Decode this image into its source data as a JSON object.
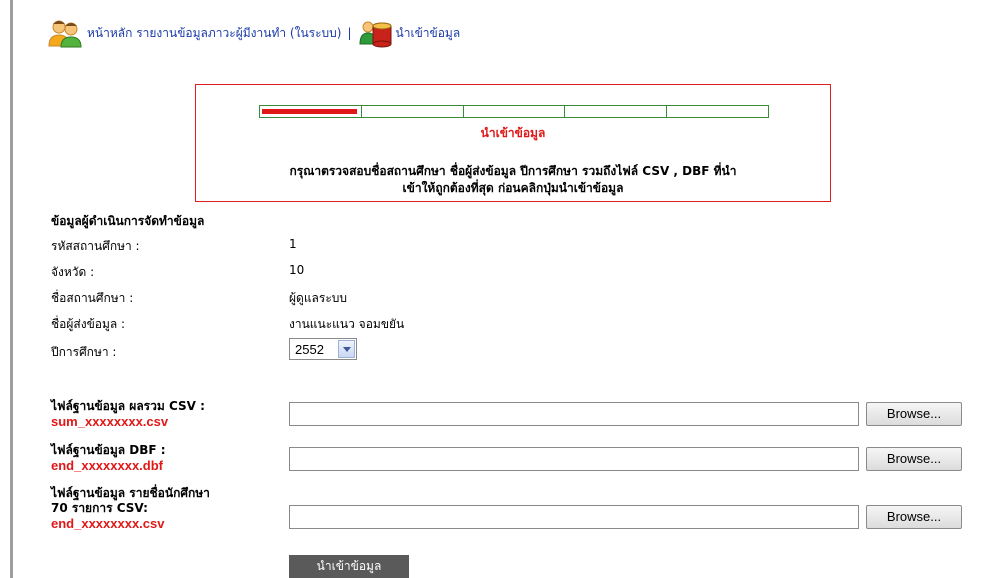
{
  "nav": {
    "home_link": "หน้าหลัก รายงานข้อมูลภาวะผู้มีงานทำ (ในระบบ)",
    "separator": "|",
    "import_link": "นำเข้าข้อมูล"
  },
  "progress": {
    "total_steps": 5,
    "current_step": 1,
    "title": "นำเข้าข้อมูล",
    "notice_line1": "กรุณาตรวจสอบชื่อสถานศึกษา ชื่อผู้ส่งข้อมูล ปีการศึกษา รวมถึงไฟล์ CSV , DBF ที่นำ",
    "notice_line2": "เข้าให้ถูกต้องที่สุด ก่อนคลิกปุ่มนำเข้าข้อมูล"
  },
  "info": {
    "section_title": "ข้อมูลผู้ดำเนินการจัดทำข้อมูล",
    "rows": [
      {
        "label": "รหัสสถานศึกษา :",
        "value": "1"
      },
      {
        "label": "จังหวัด :",
        "value": "10"
      },
      {
        "label": "ชื่อสถานศึกษา :",
        "value": "ผู้ดูแลระบบ"
      },
      {
        "label": "ชื่อผู้ส่งข้อมูล :",
        "value": "งานแนะแนว จอมขยัน"
      }
    ],
    "year_label": "ปีการศึกษา :",
    "year_value": "2552"
  },
  "files": [
    {
      "label_line1": "ไฟล์ฐานข้อมูล ผลรวม CSV :",
      "label_line2": "",
      "filename": "sum_xxxxxxxx.csv",
      "value": "",
      "browse_label": "Browse..."
    },
    {
      "label_line1": "ไฟล์ฐานข้อมูล DBF :",
      "label_line2": "",
      "filename": "end_xxxxxxxx.dbf",
      "value": "",
      "browse_label": "Browse..."
    },
    {
      "label_line1": "ไฟล์ฐานข้อมูล รายชื่อนักศึกษา",
      "label_line2": "70 รายการ CSV:",
      "filename": "end_xxxxxxxx.csv",
      "value": "",
      "browse_label": "Browse..."
    }
  ],
  "submit_label": "นำเข้าข้อมูล",
  "colors": {
    "accent_red": "#e01818",
    "link_blue": "#1a3aa8",
    "progress_green": "#3a8a3a",
    "button_gray": "#5a5a5a"
  },
  "icons": {
    "home": "users-icon",
    "import": "database-icon"
  }
}
